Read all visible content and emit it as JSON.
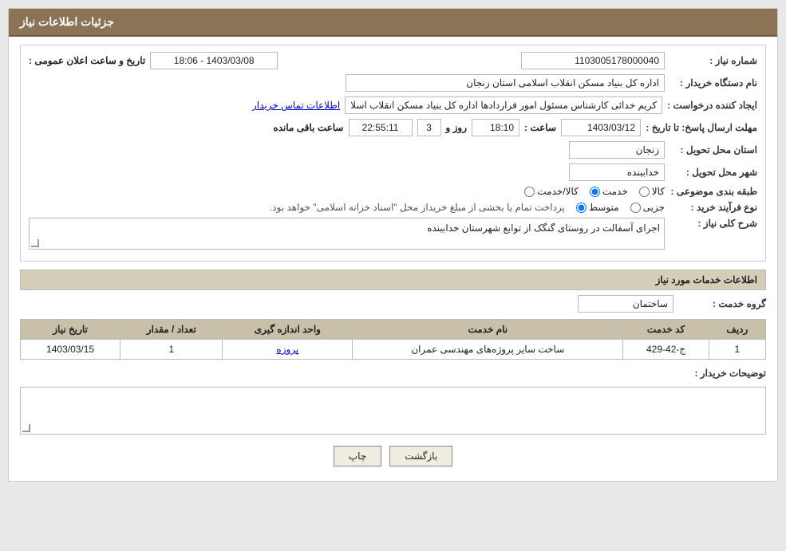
{
  "header": {
    "title": "جزئیات اطلاعات نیاز"
  },
  "fields": {
    "shomara_niaz_label": "شماره نیاز :",
    "shomara_niaz_value": "1103005178000040",
    "nam_dastgah_label": "نام دستگاه خریدار :",
    "nam_dastgah_value": "اداره کل بنیاد مسکن انقلاب اسلامی استان زنجان",
    "ijad_konande_label": "ایجاد کننده درخواست :",
    "ijad_konande_value": "کریم خدائی کارشناس مسئول امور قراردادها اداره کل بنیاد مسکن انقلاب اسلا",
    "ijad_konande_link": "اطلاعات تماس خریدار",
    "mohlat_label": "مهلت ارسال پاسخ: تا تاریخ :",
    "mohlat_date": "1403/03/12",
    "mohlat_saat_label": "ساعت :",
    "mohlat_saat": "18:10",
    "mohlat_rooz_label": "روز و",
    "mohlat_rooz": "3",
    "mohlat_baqi_label": "ساعت باقی مانده",
    "mohlat_baqi": "22:55:11",
    "ostan_label": "استان محل تحویل :",
    "ostan_value": "زنجان",
    "shahr_label": "شهر محل تحویل :",
    "shahr_value": "خداببنده",
    "tabaqe_label": "طبقه بندی موضوعی :",
    "tabaqe_kala": "کالا",
    "tabaqe_khedmat": "خدمت",
    "tabaqe_kala_khedmat": "کالا/خدمت",
    "tabaqe_selected": "khedmat",
    "nooe_farayand_label": "نوع فرآیند خرید :",
    "nooe_jozii": "جزیی",
    "nooe_mottaset": "متوسط",
    "nooe_selected": "mottaset",
    "nooe_description": "پرداخت تمام یا بخشی از مبلغ خریداز محل \"اسناد خزانه اسلامی\" خواهد بود.",
    "sharh_label": "شرح کلی نیاز :",
    "sharh_value": "اجرای آسفالت در روستای گنگک از توابع شهرستان خداببنده",
    "khedamat_label": "اطلاعات خدمات مورد نیاز",
    "grooh_label": "گروه خدمت :",
    "grooh_value": "ساختمان",
    "tarikh_elaan_label": "تاریخ و ساعت اعلان عمومی :",
    "tarikh_elaan_value": "1403/03/08 - 18:06",
    "table": {
      "headers": [
        "ردیف",
        "کد خدمت",
        "نام خدمت",
        "واحد اندازه گیری",
        "تعداد / مقدار",
        "تاریخ نیاز"
      ],
      "rows": [
        {
          "radif": "1",
          "kod": "ج-42-429",
          "name": "ساخت سایر پروژه‌های مهندسی عمران",
          "vahed": "پروزه",
          "tedad": "1",
          "tarikh": "1403/03/15"
        }
      ]
    },
    "tozihat_label": "توضیحات خریدار :",
    "tozihat_value": ""
  },
  "buttons": {
    "chap": "چاپ",
    "bazgasht": "بازگشت"
  }
}
